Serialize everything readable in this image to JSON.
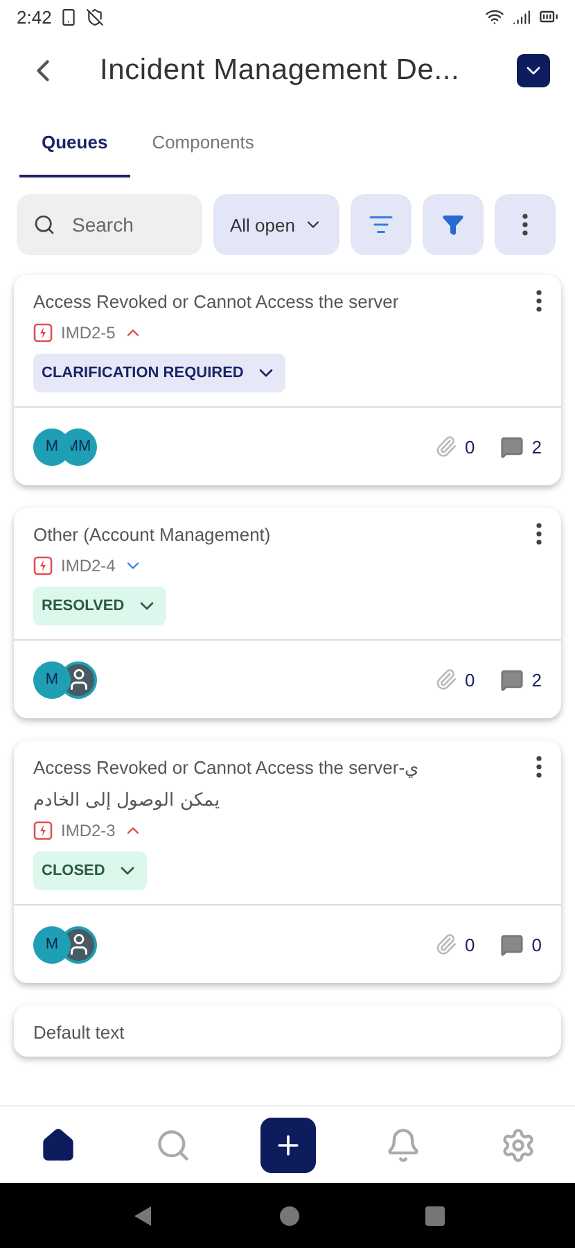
{
  "status_bar": {
    "time": "2:42"
  },
  "header": {
    "title": "Incident Management De..."
  },
  "tabs": [
    {
      "label": "Queues",
      "selected": true
    },
    {
      "label": "Components",
      "selected": false
    }
  ],
  "toolbar": {
    "search": {
      "placeholder": "Search"
    },
    "filter": {
      "label": "All open"
    }
  },
  "issues": [
    {
      "kind": "issue",
      "title": "Access Revoked or Cannot Access the server",
      "key": "IMD2-5",
      "high_priority": true,
      "status": {
        "label": "CLARIFICATION REQUIRED",
        "color": "#e6e8f8"
      },
      "assignees": [
        {
          "kind": "initials",
          "text": "M"
        },
        {
          "kind": "initials",
          "text": "MM"
        }
      ],
      "attachments": "0",
      "comments": "2"
    },
    {
      "kind": "issue",
      "title": "Other (Account Management)",
      "key": "IMD2-4",
      "high_priority": false,
      "status": {
        "label": "RESOLVED",
        "color": "#dcf7ec"
      },
      "assignees": [
        {
          "kind": "initials",
          "text": "M"
        },
        {
          "kind": "photo"
        }
      ],
      "attachments": "0",
      "comments": "2"
    },
    {
      "kind": "issue",
      "title": "Access Revoked or Cannot Access the server-ي",
      "subtitle": "يمكن الوصول إلى الخادم",
      "key": "IMD2-3",
      "high_priority": true,
      "status": {
        "label": "CLOSED",
        "color": "#dcf7ec"
      },
      "assignees": [
        {
          "kind": "initials",
          "text": "M"
        },
        {
          "kind": "photo"
        }
      ],
      "attachments": "0",
      "comments": "0"
    },
    {
      "kind": "partial",
      "title": "Default text"
    }
  ],
  "bottom_nav": [
    {
      "kind": "home",
      "selected": true
    },
    {
      "kind": "search",
      "selected": false
    },
    {
      "kind": "add",
      "selected": false
    },
    {
      "kind": "notifications",
      "selected": false
    },
    {
      "kind": "settings",
      "selected": false
    }
  ]
}
